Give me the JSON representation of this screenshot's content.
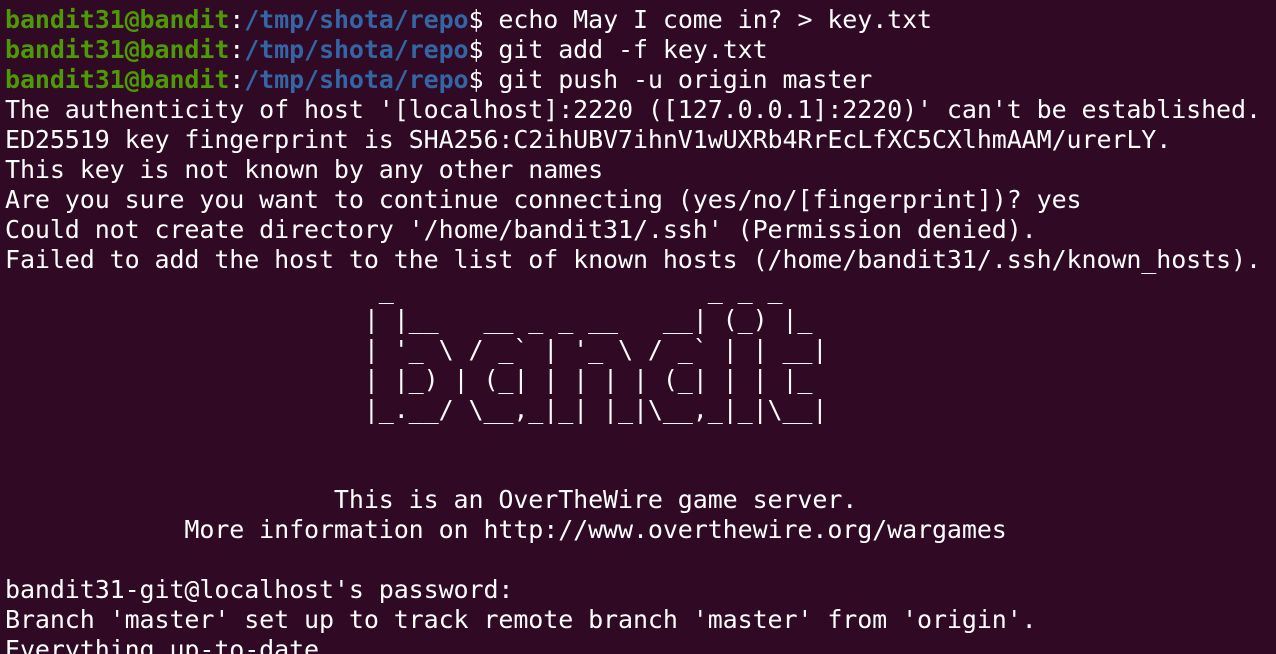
{
  "prompt": {
    "user_host": "bandit31@bandit",
    "path": "/tmp/shota/repo",
    "colon": ":",
    "dollar": "$ "
  },
  "commands": [
    "echo May I come in? > key.txt",
    "git add -f key.txt",
    "git push -u origin master"
  ],
  "ssh_output": [
    "The authenticity of host '[localhost]:2220 ([127.0.0.1]:2220)' can't be established.",
    "ED25519 key fingerprint is SHA256:C2ihUBV7ihnV1wUXRb4RrEcLfXC5CXlhmAAM/urerLY.",
    "This key is not known by any other names",
    "Are you sure you want to continue connecting (yes/no/[fingerprint])? yes",
    "Could not create directory '/home/bandit31/.ssh' (Permission denied).",
    "Failed to add the host to the list of known hosts (/home/bandit31/.ssh/known_hosts)."
  ],
  "banner_art": [
    "                         _                     _ _ _   ",
    "                        | |__   __ _ _ __   __| (_) |_ ",
    "                        | '_ \\ / _` | '_ \\ / _` | | __|",
    "                        | |_) | (_| | | | | (_| | | |_ ",
    "                        |_.__/ \\__,_|_| |_|\\__,_|_|\\__|",
    "",
    ""
  ],
  "banner_text": [
    "                      This is an OverTheWire game server.",
    "            More information on http://www.overthewire.org/wargames"
  ],
  "final_output": [
    "",
    "bandit31-git@localhost's password:",
    "Branch 'master' set up to track remote branch 'master' from 'origin'.",
    "Everything up-to-date"
  ],
  "colors": {
    "background": "#300a24",
    "prompt_user": "#4e9a06",
    "prompt_path": "#3465a4",
    "text": "#ffffff"
  }
}
